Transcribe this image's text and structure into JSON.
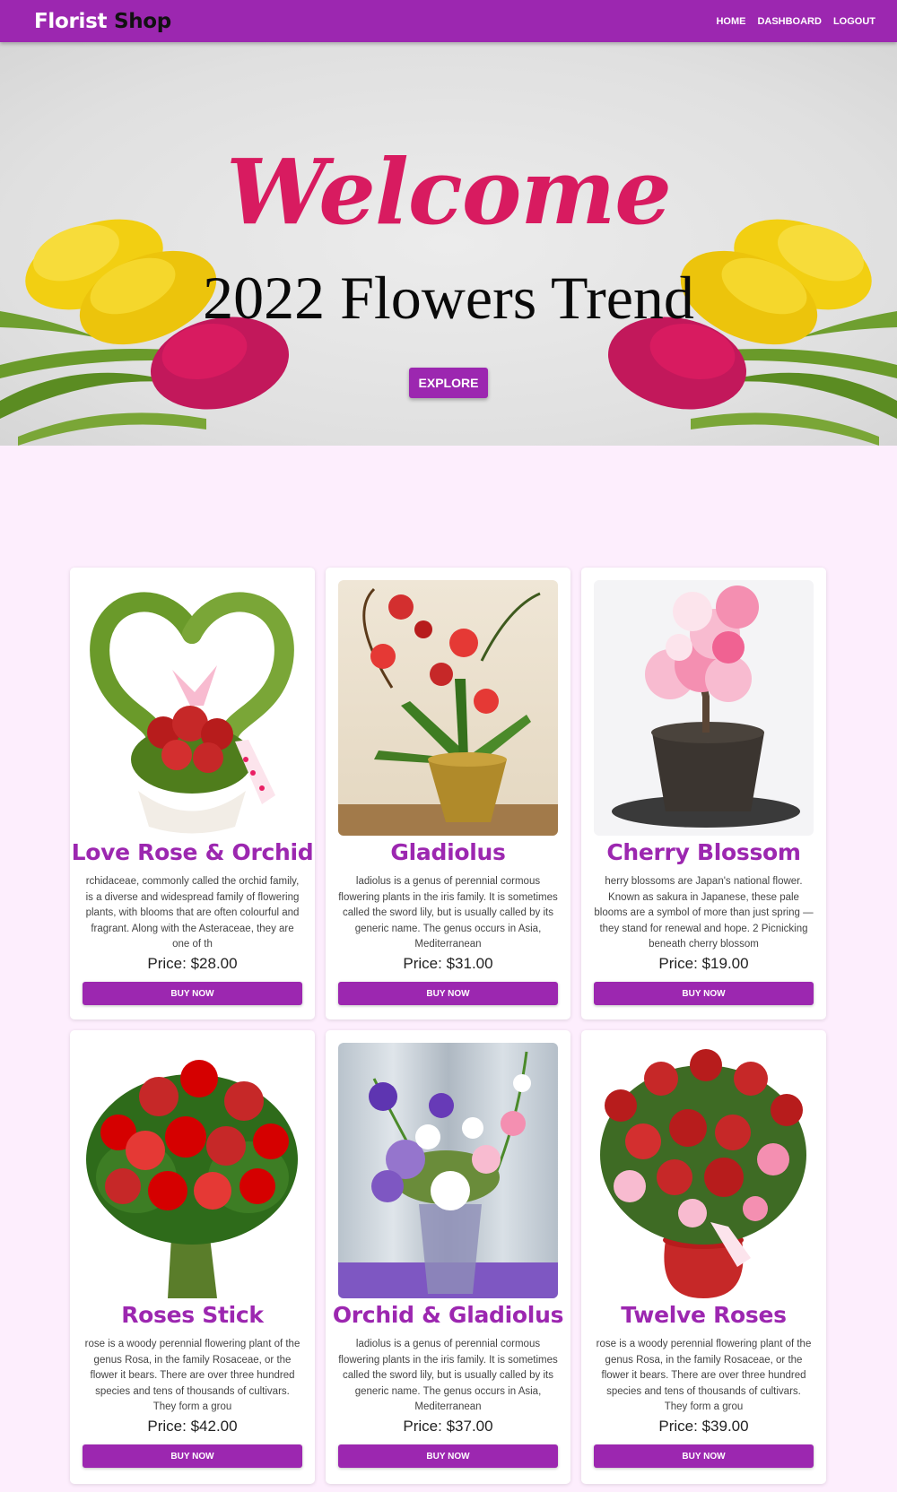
{
  "navbar": {
    "brand_part1": "Florist",
    "brand_part2": "Shop",
    "links": [
      "HOME",
      "DASHBOARD",
      "LOGOUT"
    ]
  },
  "hero": {
    "welcome": "Welcome",
    "headline": "2022 Flowers Trend",
    "button": "EXPLORE"
  },
  "colors": {
    "primary": "#9c27b0",
    "accent_pink": "#d81b60",
    "page_bg": "#fdeefd"
  },
  "products": [
    {
      "title": "Love Rose & Orchid",
      "description": "rchidaceae, commonly called the orchid family, is a diverse and widespread family of flowering plants, with blooms that are often colourful and fragrant. Along with the Asteraceae, they are one of th",
      "price": "Price: $28.00",
      "button": "BUY NOW",
      "image_icon": "heart-bouquet-icon"
    },
    {
      "title": "Gladiolus",
      "description": "ladiolus is a genus of perennial cormous flowering plants in the iris family. It is sometimes called the sword lily, but is usually called by its generic name. The genus occurs in Asia, Mediterranean",
      "price": "Price: $31.00",
      "button": "BUY NOW",
      "image_icon": "potted-orchid-icon"
    },
    {
      "title": "Cherry Blossom",
      "description": "herry blossoms are Japan's national flower. Known as sakura in Japanese, these pale blooms are a symbol of more than just spring — they stand for renewal and hope. 2 Picnicking beneath cherry blossom",
      "price": "Price: $19.00",
      "button": "BUY NOW",
      "image_icon": "bonsai-blossom-icon"
    },
    {
      "title": "Roses Stick",
      "description": "rose is a woody perennial flowering plant of the genus Rosa, in the family Rosaceae, or the flower it bears. There are over three hundred species and tens of thousands of cultivars. They form a grou",
      "price": "Price: $42.00",
      "button": "BUY NOW",
      "image_icon": "rose-bouquet-icon"
    },
    {
      "title": "Orchid & Gladiolus",
      "description": "ladiolus is a genus of perennial cormous flowering plants in the iris family. It is sometimes called the sword lily, but is usually called by its generic name. The genus occurs in Asia, Mediterranean",
      "price": "Price: $37.00",
      "button": "BUY NOW",
      "image_icon": "vase-mixed-flowers-icon"
    },
    {
      "title": "Twelve Roses",
      "description": "rose is a woody perennial flowering plant of the genus Rosa, in the family Rosaceae, or the flower it bears. There are over three hundred species and tens of thousands of cultivars. They form a grou",
      "price": "Price: $39.00",
      "button": "BUY NOW",
      "image_icon": "red-vase-roses-icon"
    }
  ]
}
